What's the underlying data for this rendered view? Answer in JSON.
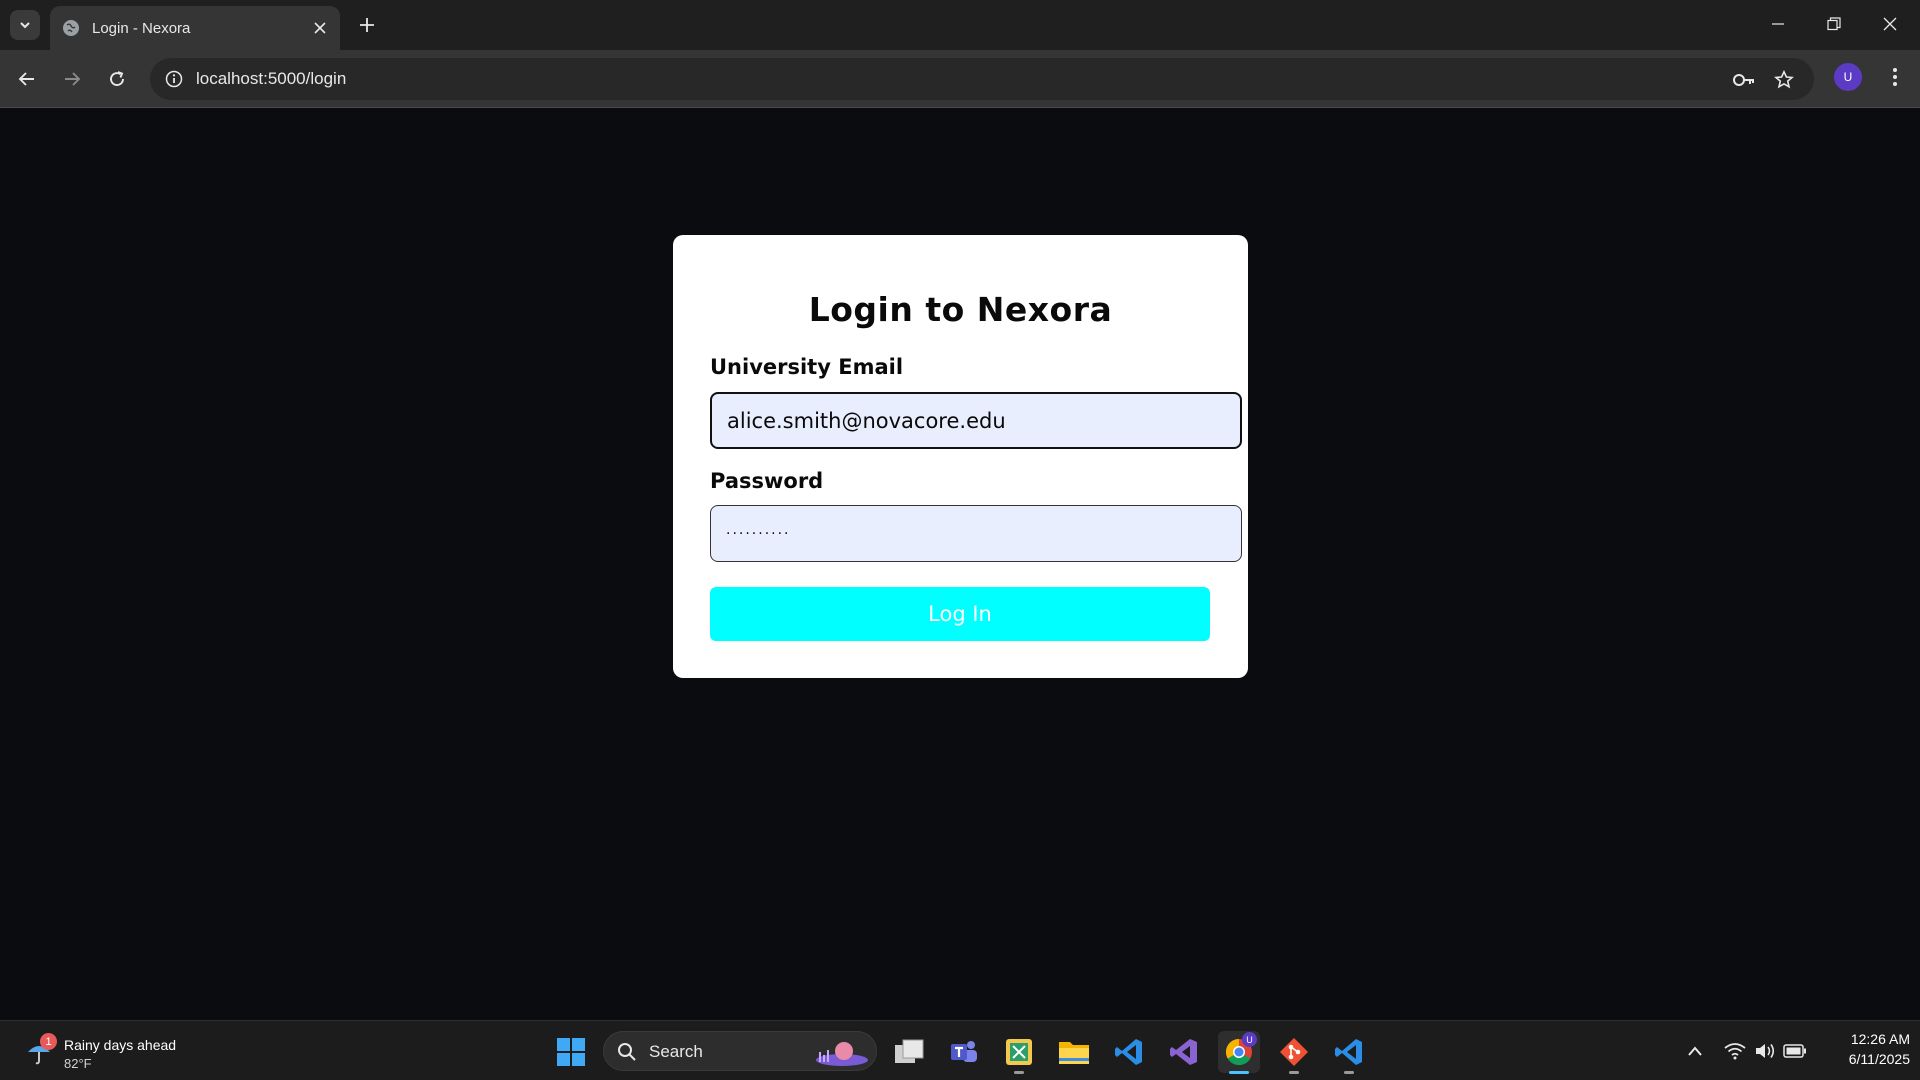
{
  "browser": {
    "tab": {
      "title": "Login - Nexora",
      "favicon": "globe-icon"
    },
    "address": {
      "url": "localhost:5000/login"
    },
    "profile_initial": "U"
  },
  "login": {
    "title": "Login to Nexora",
    "email_label": "University Email",
    "email_value": "alice.smith@novacore.edu",
    "password_label": "Password",
    "password_mask": "··········",
    "button_label": "Log In"
  },
  "taskbar": {
    "weather": {
      "title": "Rainy days ahead",
      "temp": "82°F",
      "badge": "1"
    },
    "search_label": "Search",
    "apps": [
      "start-icon",
      "task-view-icon",
      "teams-icon",
      "snipping-tool-icon",
      "file-explorer-icon",
      "vscode-icon",
      "visual-studio-icon",
      "chrome-icon",
      "git-icon",
      "vscode-icon"
    ],
    "chrome_badge": "U",
    "clock": {
      "time": "12:26 AM",
      "date": "6/11/2025"
    }
  },
  "colors": {
    "page_bg": "#0a0c10",
    "card_bg": "#ffffff",
    "button_bg": "#00ffff",
    "input_bg": "#e8eefe"
  }
}
